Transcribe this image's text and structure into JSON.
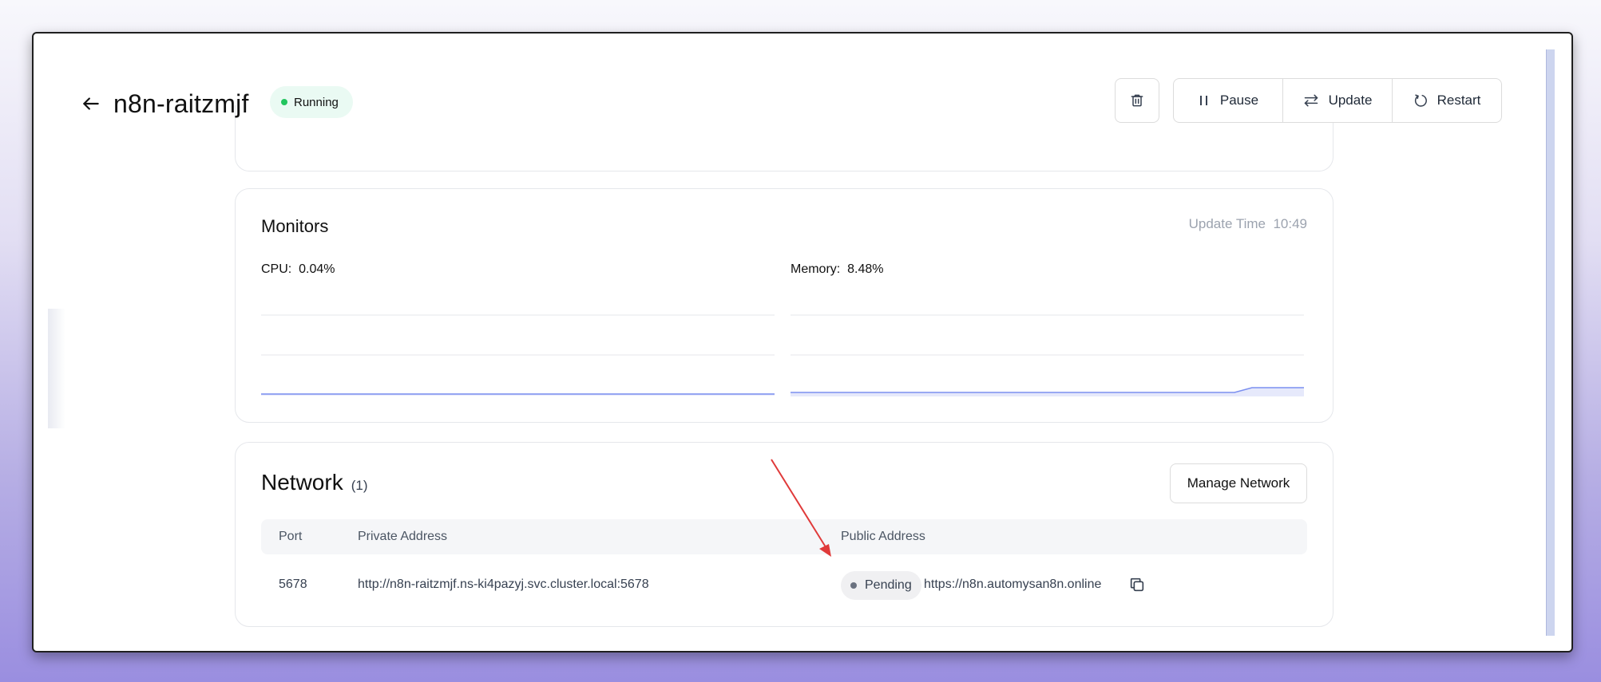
{
  "header": {
    "title": "n8n-raitzmjf",
    "status": "Running",
    "status_color": "#22c55e",
    "actions": [
      {
        "label": "Pause",
        "icon": "pause-icon"
      },
      {
        "label": "Update",
        "icon": "arrows-exchange-icon"
      },
      {
        "label": "Restart",
        "icon": "restart-icon"
      }
    ],
    "delete_icon": "trash-icon"
  },
  "monitors": {
    "title": "Monitors",
    "update_time_label": "Update Time",
    "update_time": "10:49",
    "cpu": {
      "label": "CPU:",
      "value": "0.04%"
    },
    "memory": {
      "label": "Memory:",
      "value": "8.48%"
    },
    "accent_color": "#7b8ff0"
  },
  "network": {
    "title": "Network",
    "count": "(1)",
    "manage_label": "Manage Network",
    "columns": [
      "Port",
      "Private Address",
      "Public Address"
    ],
    "rows": [
      {
        "port": "5678",
        "private_address": "http://n8n-raitzmjf.ns-ki4pazyj.svc.cluster.local:5678",
        "public_status": "Pending",
        "public_address": "https://n8n.automysan8n.online"
      }
    ],
    "pending_color": "#6b7280"
  },
  "annotation": {
    "arrow_color": "#e03a3a"
  }
}
